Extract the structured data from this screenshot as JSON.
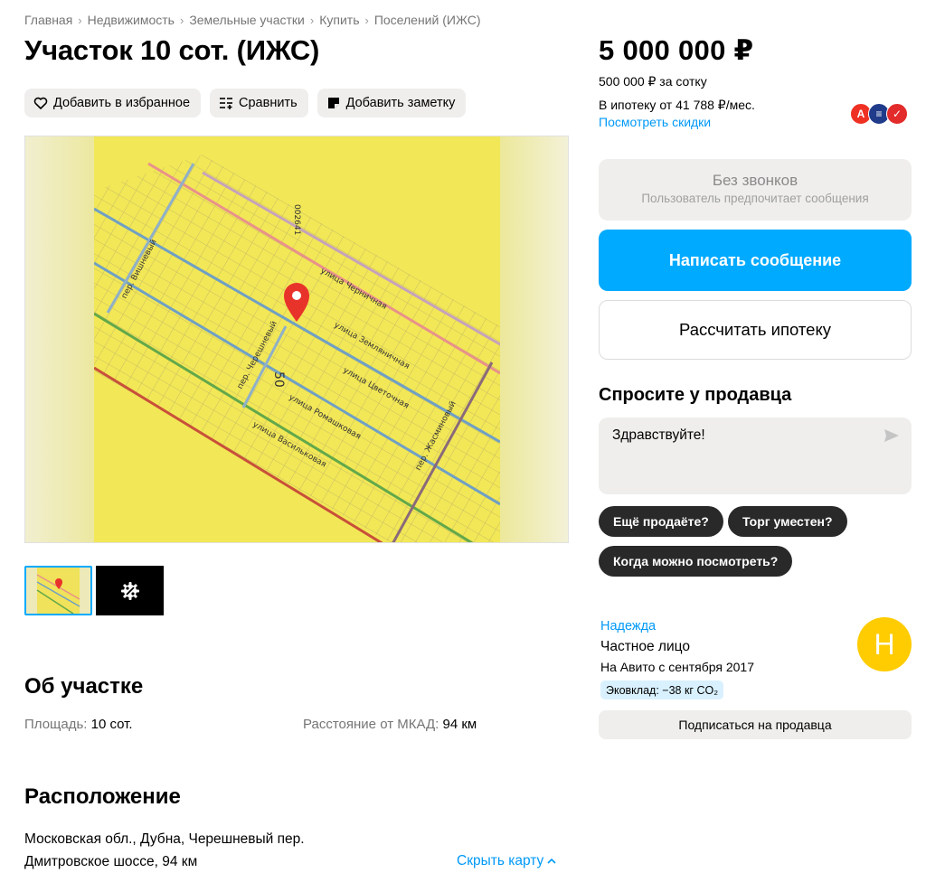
{
  "breadcrumbs": [
    "Главная",
    "Недвижимость",
    "Земельные участки",
    "Купить",
    "Поселений (ИЖС)"
  ],
  "title": "Участок 10 сот. (ИЖС)",
  "actions": {
    "favorite": "Добавить в избранное",
    "compare": "Сравнить",
    "note": "Добавить заметку"
  },
  "gallery": {
    "map_streets": [
      "улица Черничная",
      "улица Земляничная",
      "улица Цветочная",
      "улица Ромашковая",
      "улица Васильковая",
      "пер. Вишневый",
      "пер. Черешневый",
      "пер. Жасминовый"
    ],
    "map_number": "50",
    "map_code": "002641"
  },
  "about": {
    "heading": "Об участке",
    "area_label": "Площадь:",
    "area_value": "10 сот.",
    "distance_label": "Расстояние от МКАД:",
    "distance_value": "94 км"
  },
  "location": {
    "heading": "Расположение",
    "address": "Московская обл., Дубна, Черешневый пер.",
    "highway": "Дмитровское шоссе, 94 км",
    "hide_map": "Скрыть карту"
  },
  "price": {
    "main": "5 000 000 ₽",
    "per_sotka": "500 000 ₽ за сотку",
    "mortgage": "В ипотеку от 41 788 ₽/мес.",
    "discounts": "Посмотреть скидки"
  },
  "contact": {
    "no_calls_title": "Без звонков",
    "no_calls_sub": "Пользователь предпочитает сообщения",
    "write": "Написать сообщение",
    "calc_mortgage": "Рассчитать ипотеку"
  },
  "ask": {
    "heading": "Спросите у продавца",
    "message": "Здравствуйте!",
    "chips": [
      "Ещё продаёте?",
      "Торг уместен?",
      "Когда можно посмотреть?"
    ]
  },
  "seller": {
    "name": "Надежда",
    "type": "Частное лицо",
    "since": "На Авито с сентября 2017",
    "eco": "Эковклад: −38 кг CO₂",
    "avatar_letter": "Н",
    "subscribe": "Подписаться на продавца"
  },
  "colors": {
    "accent": "#00aaff",
    "link": "#0099f7",
    "avatar": "#fecc00",
    "chip": "#292929"
  }
}
